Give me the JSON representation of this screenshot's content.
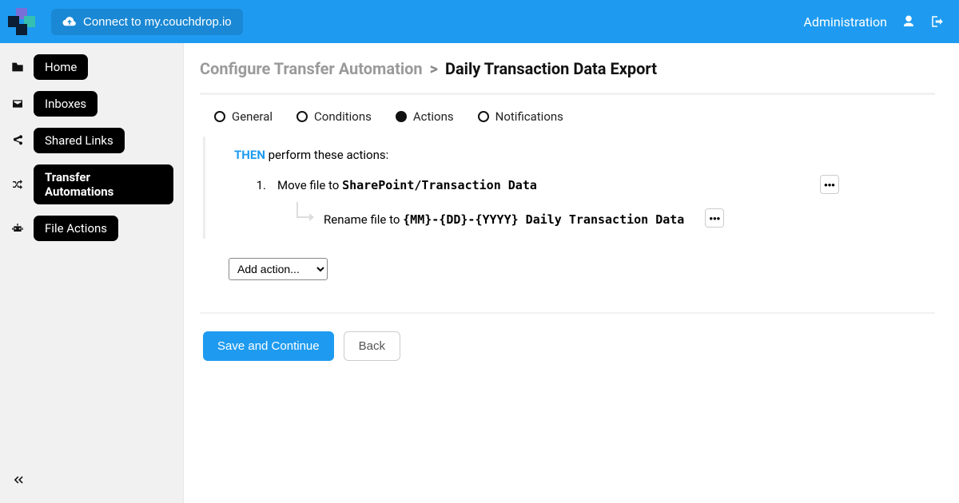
{
  "topbar": {
    "connect_label": "Connect to my.couchdrop.io",
    "admin_label": "Administration"
  },
  "sidebar": {
    "items": [
      {
        "label": "Home"
      },
      {
        "label": "Inboxes"
      },
      {
        "label": "Shared Links"
      },
      {
        "label": "Transfer Automations"
      },
      {
        "label": "File Actions"
      }
    ]
  },
  "breadcrumb": {
    "root": "Configure Transfer Automation",
    "sep": ">",
    "current": "Daily Transaction Data Export"
  },
  "tabs": {
    "general": "General",
    "conditions": "Conditions",
    "actions": "Actions",
    "notifications": "Notifications"
  },
  "panel": {
    "then": "THEN",
    "then_rest": " perform these actions:",
    "actions": [
      {
        "num": "1.",
        "prefix": "Move file to ",
        "target": "SharePoint/Transaction Data",
        "sub_prefix": "Rename file to ",
        "sub_target": "{MM}-{DD}-{YYYY} Daily Transaction Data"
      }
    ],
    "add_action_placeholder": "Add action..."
  },
  "footer": {
    "save": "Save and Continue",
    "back": "Back"
  }
}
